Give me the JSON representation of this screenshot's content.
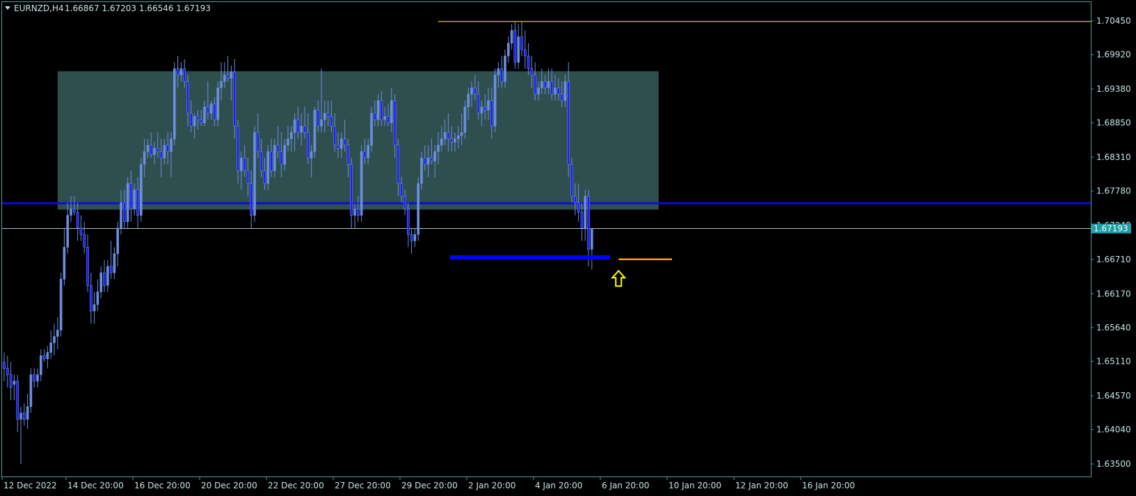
{
  "header": {
    "symbol": "EURNZD,H4",
    "ohlc": "1.66867 1.67203 1.66546 1.67193"
  },
  "colors": {
    "background": "#000000",
    "frame": "#4fa0a0",
    "axis_text": "#c8e6e6",
    "bull_candle": "#6b8fe0",
    "bear_candle": "#1a1aff",
    "zone_fill": "#2f4f4f",
    "resistance_line": "#bfa22a",
    "support_line": "#0b0bd9",
    "price_line": "#a6c8c8",
    "price_tag_bg": "#1f9fa6",
    "low_marker": "#0000ff",
    "target_marker": "#ff9f00",
    "arrow": "#ffff00"
  },
  "chart_data": {
    "type": "candlestick",
    "symbol": "EURNZD",
    "timeframe": "H4",
    "y_ticks": [
      "1.70450",
      "1.69920",
      "1.69380",
      "1.68850",
      "1.68310",
      "1.67780",
      "1.67240",
      "1.66710",
      "1.66170",
      "1.65640",
      "1.65110",
      "1.64570",
      "1.64040",
      "1.63500"
    ],
    "ylim": [
      1.6343,
      1.7058
    ],
    "x_labels": [
      "12 Dec 2022",
      "14 Dec 20:00",
      "16 Dec 20:00",
      "20 Dec 20:00",
      "22 Dec 20:00",
      "27 Dec 20:00",
      "29 Dec 20:00",
      "2 Jan 20:00",
      "4 Jan 20:00",
      "6 Jan 20:00",
      "10 Jan 20:00",
      "12 Jan 20:00",
      "16 Jan 20:00"
    ],
    "current_price_label": "1.67193",
    "current_price": 1.67193,
    "zone": {
      "from_bar": 16,
      "to_bar": 196,
      "high": 1.6966,
      "low": 1.6749
    },
    "horizontal_lines": [
      {
        "name": "resistance",
        "price": 1.7044,
        "from_bar": 130
      },
      {
        "name": "support",
        "price": 1.6759,
        "from_bar": 0
      }
    ],
    "segments": [
      {
        "name": "swing-low",
        "price": 1.6674,
        "from_bar": 133.5,
        "to_bar": 181.5
      },
      {
        "name": "target",
        "price": 1.6671,
        "from_bar": 184,
        "to_bar": 200
      }
    ],
    "arrow": {
      "bar": 184,
      "price": 1.6653,
      "direction": "up"
    },
    "candles": [
      [
        1.651,
        1.6525,
        1.648,
        1.65
      ],
      [
        1.65,
        1.652,
        1.647,
        1.649
      ],
      [
        1.649,
        1.651,
        1.645,
        1.647
      ],
      [
        1.6475,
        1.649,
        1.645,
        1.648
      ],
      [
        1.648,
        1.649,
        1.64,
        1.642
      ],
      [
        1.642,
        1.644,
        1.635,
        1.643
      ],
      [
        1.643,
        1.6445,
        1.641,
        1.642
      ],
      [
        1.642,
        1.646,
        1.6405,
        1.644
      ],
      [
        1.644,
        1.65,
        1.643,
        1.649
      ],
      [
        1.649,
        1.65,
        1.647,
        1.648
      ],
      [
        1.648,
        1.65,
        1.647,
        1.649
      ],
      [
        1.649,
        1.653,
        1.648,
        1.652
      ],
      [
        1.652,
        1.653,
        1.651,
        1.6515
      ],
      [
        1.6515,
        1.6535,
        1.65,
        1.6525
      ],
      [
        1.6525,
        1.656,
        1.6515,
        1.654
      ],
      [
        1.654,
        1.657,
        1.652,
        1.655
      ],
      [
        1.655,
        1.658,
        1.653,
        1.656
      ],
      [
        1.656,
        1.665,
        1.655,
        1.664
      ],
      [
        1.664,
        1.672,
        1.663,
        1.669
      ],
      [
        1.669,
        1.676,
        1.668,
        1.674
      ],
      [
        1.674,
        1.677,
        1.673,
        1.675
      ],
      [
        1.675,
        1.677,
        1.674,
        1.6745
      ],
      [
        1.6745,
        1.676,
        1.67,
        1.672
      ],
      [
        1.672,
        1.674,
        1.67,
        1.671
      ],
      [
        1.671,
        1.673,
        1.668,
        1.669
      ],
      [
        1.669,
        1.671,
        1.662,
        1.663
      ],
      [
        1.663,
        1.665,
        1.657,
        1.659
      ],
      [
        1.659,
        1.662,
        1.657,
        1.66
      ],
      [
        1.66,
        1.664,
        1.659,
        1.662
      ],
      [
        1.662,
        1.666,
        1.661,
        1.665
      ],
      [
        1.665,
        1.667,
        1.662,
        1.663
      ],
      [
        1.663,
        1.667,
        1.662,
        1.666
      ],
      [
        1.666,
        1.67,
        1.664,
        1.665
      ],
      [
        1.665,
        1.669,
        1.664,
        1.668
      ],
      [
        1.668,
        1.673,
        1.666,
        1.672
      ],
      [
        1.672,
        1.678,
        1.671,
        1.676
      ],
      [
        1.676,
        1.678,
        1.672,
        1.673
      ],
      [
        1.673,
        1.68,
        1.672,
        1.679
      ],
      [
        1.679,
        1.681,
        1.673,
        1.675
      ],
      [
        1.675,
        1.679,
        1.674,
        1.678
      ],
      [
        1.678,
        1.68,
        1.672,
        1.674
      ],
      [
        1.674,
        1.683,
        1.673,
        1.682
      ],
      [
        1.682,
        1.686,
        1.68,
        1.684
      ],
      [
        1.684,
        1.686,
        1.683,
        1.685
      ],
      [
        1.685,
        1.687,
        1.683,
        1.6835
      ],
      [
        1.6835,
        1.6855,
        1.682,
        1.6845
      ],
      [
        1.6845,
        1.687,
        1.683,
        1.684
      ],
      [
        1.684,
        1.686,
        1.68,
        1.683
      ],
      [
        1.683,
        1.686,
        1.682,
        1.685
      ],
      [
        1.685,
        1.687,
        1.682,
        1.684
      ],
      [
        1.684,
        1.687,
        1.68,
        1.686
      ],
      [
        1.686,
        1.698,
        1.685,
        1.697
      ],
      [
        1.697,
        1.699,
        1.694,
        1.696
      ],
      [
        1.696,
        1.698,
        1.695,
        1.697
      ],
      [
        1.697,
        1.6985,
        1.694,
        1.695
      ],
      [
        1.695,
        1.696,
        1.688,
        1.69
      ],
      [
        1.69,
        1.692,
        1.687,
        1.688
      ],
      [
        1.688,
        1.69,
        1.686,
        1.6895
      ],
      [
        1.6895,
        1.6905,
        1.6875,
        1.689
      ],
      [
        1.689,
        1.6905,
        1.688,
        1.6885
      ],
      [
        1.6885,
        1.692,
        1.688,
        1.691
      ],
      [
        1.691,
        1.695,
        1.689,
        1.69
      ],
      [
        1.69,
        1.692,
        1.689,
        1.6915
      ],
      [
        1.6915,
        1.6925,
        1.688,
        1.689
      ],
      [
        1.689,
        1.695,
        1.688,
        1.694
      ],
      [
        1.694,
        1.698,
        1.692,
        1.695
      ],
      [
        1.695,
        1.698,
        1.694,
        1.696
      ],
      [
        1.696,
        1.699,
        1.695,
        1.6955
      ],
      [
        1.6955,
        1.6975,
        1.692,
        1.6965
      ],
      [
        1.6965,
        1.6985,
        1.686,
        1.688
      ],
      [
        1.688,
        1.689,
        1.679,
        1.681
      ],
      [
        1.681,
        1.684,
        1.678,
        1.683
      ],
      [
        1.683,
        1.685,
        1.68,
        1.681
      ],
      [
        1.681,
        1.683,
        1.677,
        1.679
      ],
      [
        1.679,
        1.681,
        1.672,
        1.674
      ],
      [
        1.674,
        1.688,
        1.673,
        1.687
      ],
      [
        1.687,
        1.69,
        1.683,
        1.684
      ],
      [
        1.684,
        1.686,
        1.68,
        1.681
      ],
      [
        1.681,
        1.683,
        1.678,
        1.679
      ],
      [
        1.679,
        1.685,
        1.678,
        1.684
      ],
      [
        1.684,
        1.686,
        1.68,
        1.681
      ],
      [
        1.681,
        1.686,
        1.68,
        1.685
      ],
      [
        1.685,
        1.688,
        1.683,
        1.684
      ],
      [
        1.684,
        1.687,
        1.68,
        1.682
      ],
      [
        1.682,
        1.686,
        1.681,
        1.685
      ],
      [
        1.685,
        1.688,
        1.684,
        1.686
      ],
      [
        1.686,
        1.688,
        1.684,
        1.687
      ],
      [
        1.687,
        1.69,
        1.684,
        1.689
      ],
      [
        1.689,
        1.691,
        1.686,
        1.687
      ],
      [
        1.687,
        1.69,
        1.685,
        1.688
      ],
      [
        1.688,
        1.691,
        1.686,
        1.687
      ],
      [
        1.687,
        1.69,
        1.682,
        1.683
      ],
      [
        1.683,
        1.685,
        1.68,
        1.684
      ],
      [
        1.684,
        1.691,
        1.683,
        1.6905
      ],
      [
        1.6905,
        1.692,
        1.687,
        1.688
      ],
      [
        1.688,
        1.697,
        1.687,
        1.689
      ],
      [
        1.689,
        1.692,
        1.687,
        1.69
      ],
      [
        1.69,
        1.692,
        1.688,
        1.6895
      ],
      [
        1.6895,
        1.692,
        1.687,
        1.688
      ],
      [
        1.688,
        1.69,
        1.684,
        1.685
      ],
      [
        1.685,
        1.687,
        1.683,
        1.6845
      ],
      [
        1.6845,
        1.687,
        1.683,
        1.686
      ],
      [
        1.686,
        1.689,
        1.684,
        1.685
      ],
      [
        1.685,
        1.686,
        1.68,
        1.682
      ],
      [
        1.682,
        1.683,
        1.672,
        1.674
      ],
      [
        1.674,
        1.676,
        1.672,
        1.675
      ],
      [
        1.675,
        1.677,
        1.673,
        1.674
      ],
      [
        1.674,
        1.685,
        1.673,
        1.684
      ],
      [
        1.684,
        1.686,
        1.682,
        1.683
      ],
      [
        1.683,
        1.686,
        1.682,
        1.685
      ],
      [
        1.685,
        1.691,
        1.684,
        1.69
      ],
      [
        1.69,
        1.692,
        1.688,
        1.689
      ],
      [
        1.689,
        1.693,
        1.688,
        1.692
      ],
      [
        1.692,
        1.6935,
        1.688,
        1.689
      ],
      [
        1.689,
        1.691,
        1.688,
        1.6895
      ],
      [
        1.6895,
        1.6915,
        1.688,
        1.6885
      ],
      [
        1.6885,
        1.694,
        1.687,
        1.692
      ],
      [
        1.692,
        1.693,
        1.683,
        1.685
      ],
      [
        1.685,
        1.686,
        1.677,
        1.679
      ],
      [
        1.679,
        1.68,
        1.676,
        1.677
      ],
      [
        1.677,
        1.678,
        1.674,
        1.675
      ],
      [
        1.675,
        1.676,
        1.669,
        1.671
      ],
      [
        1.671,
        1.672,
        1.668,
        1.67
      ],
      [
        1.67,
        1.672,
        1.669,
        1.671
      ],
      [
        1.671,
        1.68,
        1.67,
        1.679
      ],
      [
        1.679,
        1.684,
        1.678,
        1.683
      ],
      [
        1.683,
        1.685,
        1.681,
        1.682
      ],
      [
        1.682,
        1.685,
        1.68,
        1.683
      ],
      [
        1.683,
        1.686,
        1.682,
        1.6825
      ],
      [
        1.6825,
        1.685,
        1.68,
        1.684
      ],
      [
        1.684,
        1.687,
        1.682,
        1.685
      ],
      [
        1.685,
        1.688,
        1.684,
        1.686
      ],
      [
        1.686,
        1.689,
        1.685,
        1.687
      ],
      [
        1.687,
        1.69,
        1.684,
        1.686
      ],
      [
        1.686,
        1.688,
        1.684,
        1.6855
      ],
      [
        1.6855,
        1.687,
        1.684,
        1.686
      ],
      [
        1.686,
        1.688,
        1.6845,
        1.6865
      ],
      [
        1.6865,
        1.69,
        1.685,
        1.687
      ],
      [
        1.687,
        1.692,
        1.686,
        1.691
      ],
      [
        1.691,
        1.694,
        1.689,
        1.693
      ],
      [
        1.693,
        1.695,
        1.691,
        1.694
      ],
      [
        1.694,
        1.696,
        1.692,
        1.693
      ],
      [
        1.693,
        1.695,
        1.689,
        1.69
      ],
      [
        1.69,
        1.692,
        1.688,
        1.691
      ],
      [
        1.691,
        1.693,
        1.689,
        1.6905
      ],
      [
        1.6905,
        1.694,
        1.689,
        1.692
      ],
      [
        1.692,
        1.694,
        1.686,
        1.688
      ],
      [
        1.688,
        1.697,
        1.687,
        1.696
      ],
      [
        1.696,
        1.698,
        1.694,
        1.697
      ],
      [
        1.697,
        1.699,
        1.694,
        1.695
      ],
      [
        1.695,
        1.7,
        1.694,
        1.699
      ],
      [
        1.699,
        1.702,
        1.698,
        1.701
      ],
      [
        1.701,
        1.704,
        1.7,
        1.703
      ],
      [
        1.703,
        1.7045,
        1.697,
        1.698
      ],
      [
        1.698,
        1.704,
        1.697,
        1.702
      ],
      [
        1.702,
        1.7045,
        1.699,
        1.7
      ],
      [
        1.7,
        1.703,
        1.697,
        1.699
      ],
      [
        1.699,
        1.701,
        1.696,
        1.697
      ],
      [
        1.697,
        1.699,
        1.694,
        1.696
      ],
      [
        1.696,
        1.698,
        1.692,
        1.693
      ],
      [
        1.693,
        1.695,
        1.692,
        1.694
      ],
      [
        1.694,
        1.697,
        1.693,
        1.695
      ],
      [
        1.695,
        1.696,
        1.693,
        1.694
      ],
      [
        1.694,
        1.697,
        1.693,
        1.695
      ],
      [
        1.695,
        1.697,
        1.692,
        1.693
      ],
      [
        1.693,
        1.696,
        1.692,
        1.694
      ],
      [
        1.694,
        1.6955,
        1.692,
        1.693
      ],
      [
        1.693,
        1.695,
        1.691,
        1.692
      ],
      [
        1.692,
        1.696,
        1.691,
        1.695
      ],
      [
        1.695,
        1.698,
        1.68,
        1.682
      ],
      [
        1.682,
        1.683,
        1.676,
        1.677
      ],
      [
        1.677,
        1.679,
        1.674,
        1.676
      ],
      [
        1.676,
        1.679,
        1.673,
        1.6745
      ],
      [
        1.6745,
        1.676,
        1.67,
        1.672
      ],
      [
        1.672,
        1.678,
        1.67,
        1.677
      ],
      [
        1.677,
        1.678,
        1.666,
        1.6687
      ],
      [
        1.6687,
        1.672,
        1.6655,
        1.6719
      ]
    ]
  }
}
